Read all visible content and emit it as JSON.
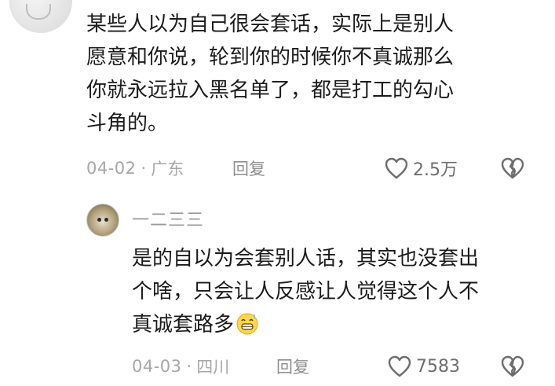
{
  "comment": {
    "text": "某些人以为自己很会套话，实际上是别人\n愿意和你说，轮到你的时候你不真诚那么\n你就永远拉入黑名单了，都是打工的勾心\n斗角的。",
    "date": "04-02",
    "separator": "·",
    "location": "广东",
    "reply_label": "回复",
    "like_count": "2.5万"
  },
  "reply": {
    "username": "一二三三",
    "text": "是的自以为会套别人话，其实也没套出\n个啥，只会让人反感让人觉得这个人不\n真诚套路多",
    "emoji": "grinning-sweat-emoji",
    "date": "04-03",
    "separator": "·",
    "location": "四川",
    "reply_label": "回复",
    "like_count": "7583"
  },
  "colors": {
    "text": "#1b1b1b",
    "meta": "#a7a7a7",
    "icon": "#6d6d6d"
  }
}
